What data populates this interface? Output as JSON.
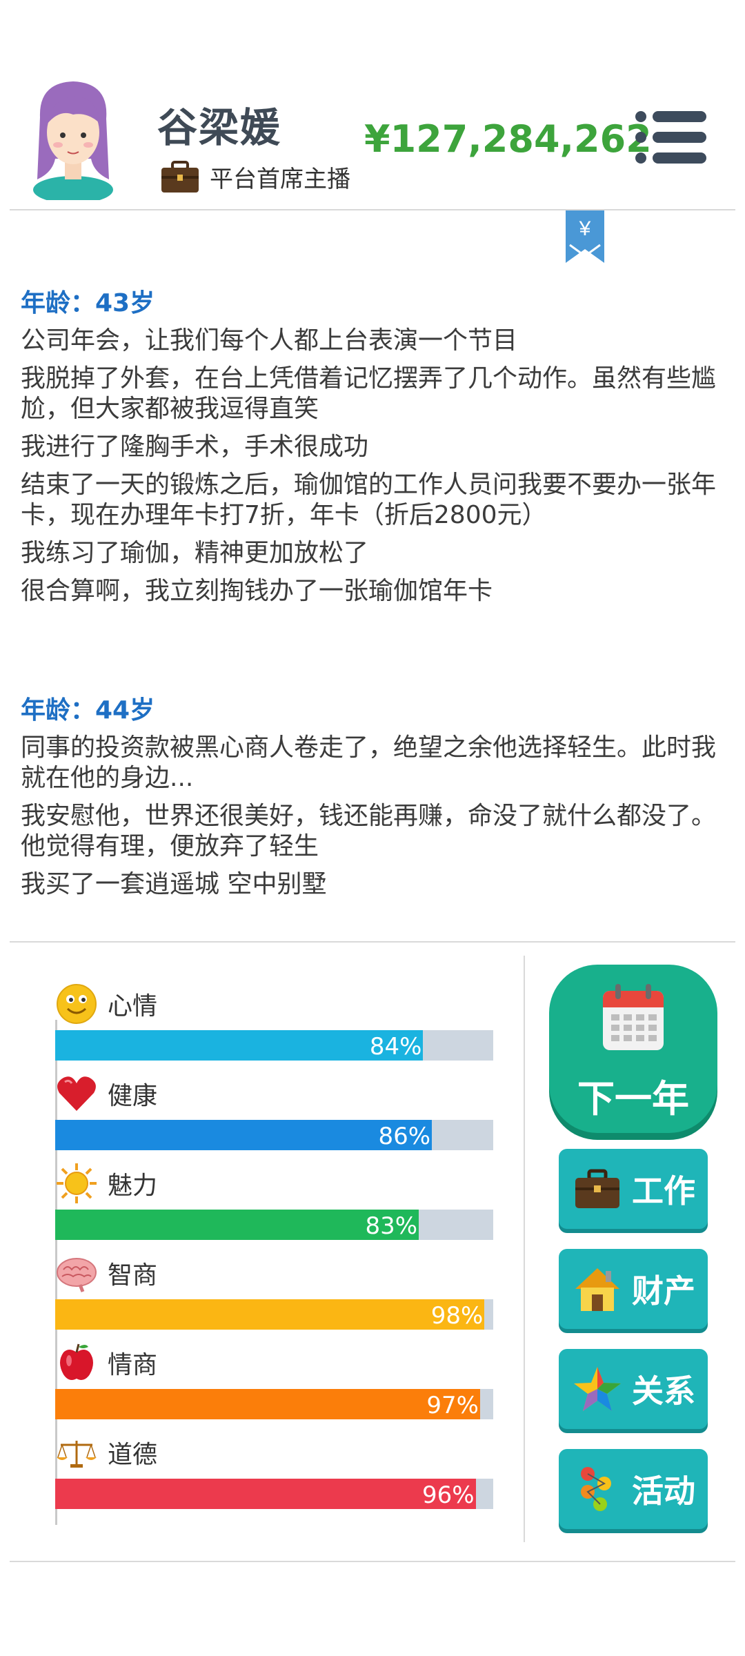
{
  "header": {
    "name": "谷梁媛",
    "job_title": "平台首席主播",
    "money": "¥127,284,262"
  },
  "bookmark": {
    "symbol": "¥"
  },
  "log": [
    {
      "age": "年龄：43岁",
      "entries": [
        "公司年会，让我们每个人都上台表演一个节目",
        "我脱掉了外套，在台上凭借着记忆摆弄了几个动作。虽然有些尴尬，但大家都被我逗得直笑",
        "我进行了隆胸手术，手术很成功",
        "结束了一天的锻炼之后，瑜伽馆的工作人员问我要不要办一张年卡，现在办理年卡打7折，年卡（折后2800元）",
        "我练习了瑜伽，精神更加放松了",
        "很合算啊，我立刻掏钱办了一张瑜伽馆年卡"
      ]
    },
    {
      "age": "年龄：44岁",
      "entries": [
        "同事的投资款被黑心商人卷走了，绝望之余他选择轻生。此时我就在他的身边...",
        "我安慰他，世界还很美好，钱还能再赚，命没了就什么都没了。他觉得有理，便放弃了轻生",
        "我买了一套逍遥城 空中别墅"
      ]
    }
  ],
  "stats": [
    {
      "label": "心情",
      "percent": 84,
      "value_text": "84%",
      "color": "#1ab3e0",
      "icon": "smiley-icon"
    },
    {
      "label": "健康",
      "percent": 86,
      "value_text": "86%",
      "color": "#1a8ae0",
      "icon": "heart-icon"
    },
    {
      "label": "魅力",
      "percent": 83,
      "value_text": "83%",
      "color": "#1fb85a",
      "icon": "sun-icon"
    },
    {
      "label": "智商",
      "percent": 98,
      "value_text": "98%",
      "color": "#fbb613",
      "icon": "brain-icon"
    },
    {
      "label": "情商",
      "percent": 97,
      "value_text": "97%",
      "color": "#fb7e0a",
      "icon": "apple-icon"
    },
    {
      "label": "道德",
      "percent": 96,
      "value_text": "96%",
      "color": "#ec3a4d",
      "icon": "scales-icon"
    }
  ],
  "buttons": {
    "next_year": "下一年",
    "work": "工作",
    "property": "财产",
    "relations": "关系",
    "activities": "活动"
  }
}
